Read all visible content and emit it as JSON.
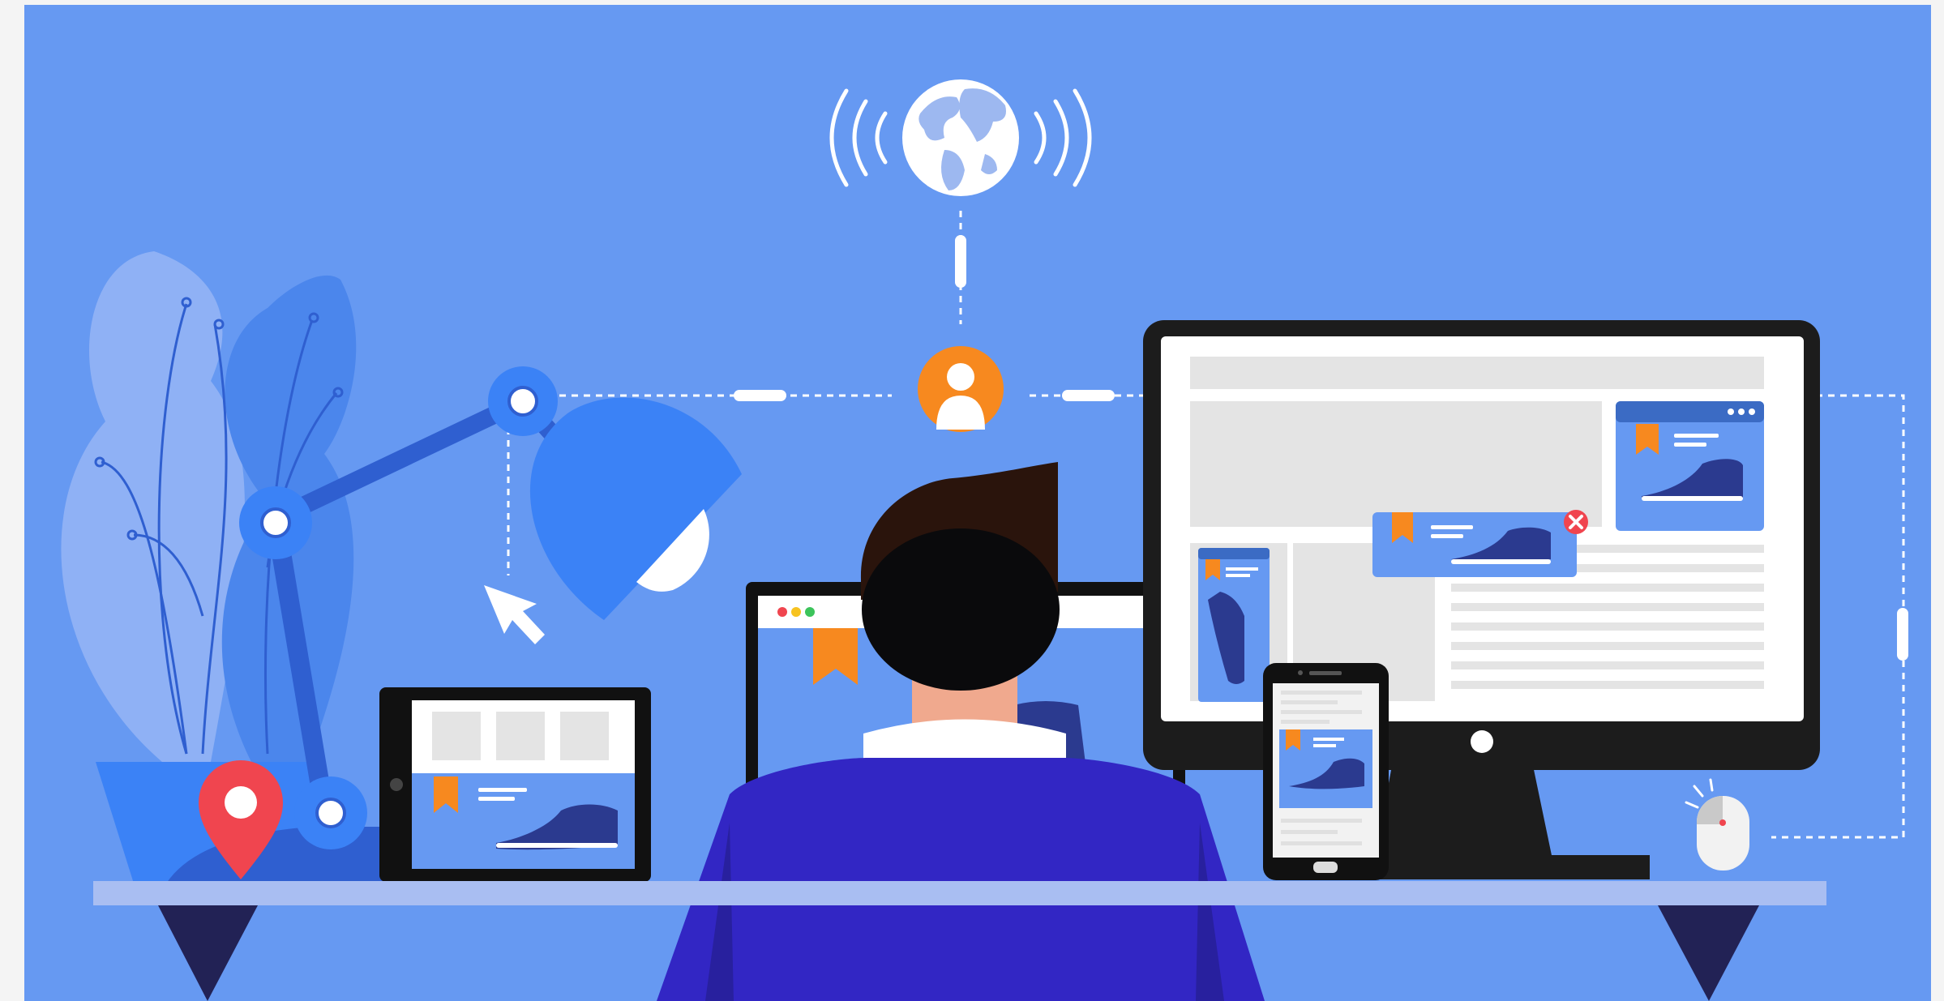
{
  "scene": {
    "description_kind": "flat-illustration",
    "theme": "omnichannel ecommerce / responsive devices",
    "colors": {
      "background": "#6699F2",
      "frame": "#F2F2F2",
      "accent_blue": "#3B82F6",
      "dark_blue": "#2F5FD0",
      "plant_light": "#8FB1F5",
      "plant_mid": "#4B86EC",
      "shirt": "#3226C4",
      "hair": "#2A140C",
      "skin": "#F0A98E",
      "device_dark": "#1C1C1C",
      "screen_light": "#F2F2F2",
      "panel_gray": "#E4E4E4",
      "orange": "#F7891F",
      "red": "#F0454F",
      "desk": "#A9BEF2",
      "desk_leg": "#222255",
      "shoe": "#2B3A8F"
    },
    "icons": [
      "globe-icon",
      "signal-waves-icon",
      "user-avatar-icon",
      "cursor-arrow-icon",
      "location-pin-icon",
      "close-icon",
      "bookmark-icon",
      "mouse-icon",
      "shoe-icon"
    ]
  }
}
